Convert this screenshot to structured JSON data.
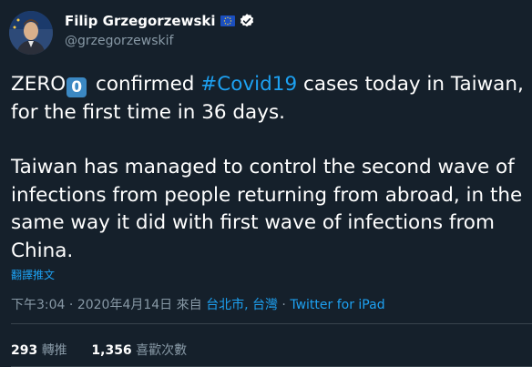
{
  "author": {
    "name": "Filip Grzegorzewski",
    "handle": "@grzegorzewskif"
  },
  "tweet": {
    "line1_prefix": "ZERO",
    "keycap_digit": "0",
    "line1_mid": " confirmed ",
    "hashtag": "#Covid19",
    "line1_suffix": " cases today in Taiwan, for the first time in 36 days.",
    "paragraph2": "Taiwan has managed to control the second wave of infections from people returning from abroad, in the same way it did with first wave of infections from China."
  },
  "translate_label": "翻譯推文",
  "meta": {
    "time": "下午3:04",
    "sep1": " · ",
    "date": "2020年4月14日",
    "from_label": " 來自 ",
    "location": "台北市, 台灣",
    "sep2": " · ",
    "source": "Twitter for iPad"
  },
  "stats": {
    "retweets_count": "293",
    "retweets_label": "轉推",
    "likes_count": "1,356",
    "likes_label": "喜歡次數"
  },
  "colors": {
    "background": "#15202b",
    "accent": "#1da1f2",
    "muted": "#8899a6",
    "divider": "#38444d"
  },
  "icons": [
    "eu-flag-icon",
    "verified-badge-icon",
    "keycap-zero-icon"
  ]
}
